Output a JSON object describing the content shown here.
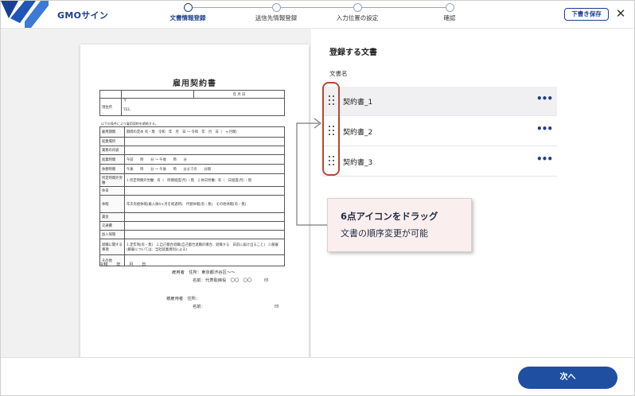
{
  "header": {
    "brand": "GMOサイン",
    "steps": [
      {
        "label": "文書情報登録",
        "active": true
      },
      {
        "label": "送信先情報登録",
        "active": false
      },
      {
        "label": "入力位置の設定",
        "active": false
      },
      {
        "label": "確認",
        "active": false
      }
    ],
    "draft_label": "下書き保存",
    "close_label": "✕"
  },
  "document_preview": {
    "title": "雇用契約書",
    "date_label": "年  月  日",
    "address_label": "現住所",
    "postal_mark": "〒",
    "tel_label": "TEL",
    "intro_note": "以下の条件により雇用契約を締結する。",
    "rows": [
      {
        "label": "雇用期間",
        "value": "期間の定め 有・無　令和　年　月　日 ～ 令和　年　月　日（　ヶ月間）"
      },
      {
        "label": "就業場所",
        "value": ""
      },
      {
        "label": "業務の内容",
        "value": ""
      },
      {
        "label": "就業時間",
        "value": "午前　　時　　分 ～ 午後　　時　　分"
      },
      {
        "label": "休憩時間",
        "value": "午後　　時　　分 ～ 午後　　時　　分までの　　分間"
      },
      {
        "label": "所定時間外労働",
        "value": "1.所定時間外労働：有（　時間程度/月）・無　2.休日労働：有（　日程度/月）・無"
      },
      {
        "label": "休日",
        "value": ""
      },
      {
        "label": "休暇",
        "value": "年次有給休暇(雇入後6ヶ月を経過時)　代替休暇(有・無)　その他休暇(有・無)"
      },
      {
        "label": "賃金",
        "value": ""
      },
      {
        "label": "交通費",
        "value": ""
      },
      {
        "label": "加入保険",
        "value": ""
      },
      {
        "label": "退職に関する事項",
        "value": "1.定年制(有・無)　2.自己都合退職(自己都合退職の場合、退職する　日前に届け出ること)　3.解雇(解雇については、当社就業規則による)"
      },
      {
        "label": "その他",
        "value": ""
      }
    ],
    "sign_date": "令和　　年　　月　　日",
    "employer_line1": "雇用者　住所：東京都渋谷区〜〜",
    "employer_line2": "名前：代表取締役　〇〇　〇〇　　　印",
    "employee_line1": "被雇用者　住所：",
    "employee_line2": "名前：",
    "seal_mark": "印"
  },
  "panel": {
    "section_title": "登録する文書",
    "column_header": "文書名",
    "documents": [
      {
        "name": "契約書_1"
      },
      {
        "name": "契約書_2"
      },
      {
        "name": "契約書_3"
      }
    ],
    "more_label": "•••"
  },
  "callout": {
    "line1": "6点アイコンをドラッグ",
    "line2": "文書の順序変更が可能"
  },
  "footer": {
    "next_label": "次へ"
  },
  "colors": {
    "brand_navy": "#1f3f8a",
    "primary_button": "#1f4fa0",
    "highlight_red": "#b5492f",
    "callout_bg": "#fbeeee"
  }
}
